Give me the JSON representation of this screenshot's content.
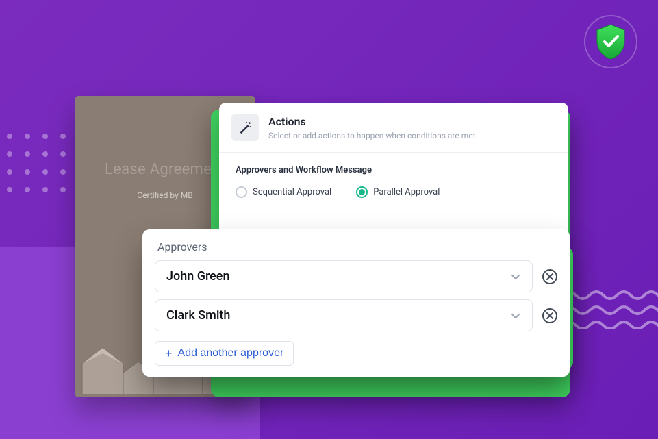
{
  "document": {
    "title": "Lease Agreement",
    "certified_text": "Certified by MB"
  },
  "actions": {
    "title": "Actions",
    "subtitle": "Select or add actions to happen when conditions are met",
    "section_label": "Approvers and Workflow Message",
    "radio_sequential": "Sequential Approval",
    "radio_parallel": "Parallel Approval",
    "selected": "parallel"
  },
  "approvers": {
    "title": "Approvers",
    "items": [
      {
        "name": "John Green"
      },
      {
        "name": "Clark Smith"
      }
    ],
    "add_label": "Add another approver"
  },
  "icons": {
    "shield": "shield-check-icon",
    "wand": "magic-wand-icon",
    "chevron": "chevron-down-icon",
    "remove": "close-circle-icon",
    "plus": "plus-icon"
  },
  "colors": {
    "bg": "#7b2cbf",
    "green": "#3fcf5e",
    "teal": "#14b88a",
    "link": "#2c5dd8"
  }
}
